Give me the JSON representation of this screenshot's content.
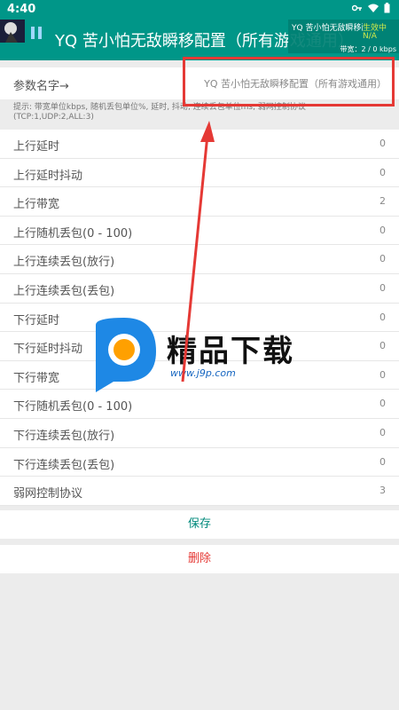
{
  "status_bar": {
    "time": "4:40"
  },
  "app_bar": {
    "title": "YQ 苦小怕无敌瞬移配置（所有游戏通用）"
  },
  "overlay": {
    "name": "YQ 苦小怕无敌瞬移配置",
    "status": "生效中",
    "status2": "N/A",
    "bandwidth": "带宽：2 / 0 kbps"
  },
  "config": {
    "name_label": "参数名字→",
    "name_value": "YQ 苦小怕无敌瞬移配置（所有游戏通用）",
    "hint_line1": "提示: 带宽单位kbps, 随机丢包单位%, 延时, 抖动, 连续丢包单位ms, 弱网控制协议",
    "hint_line2": "(TCP:1,UDP:2,ALL:3)"
  },
  "params": [
    {
      "label": "上行延时",
      "value": "0"
    },
    {
      "label": "上行延时抖动",
      "value": "0"
    },
    {
      "label": "上行带宽",
      "value": "2"
    },
    {
      "label": "上行随机丢包(0 - 100)",
      "value": "0"
    },
    {
      "label": "上行连续丢包(放行)",
      "value": "0"
    },
    {
      "label": "上行连续丢包(丢包)",
      "value": "0"
    },
    {
      "label": "下行延时",
      "value": "0"
    },
    {
      "label": "下行延时抖动",
      "value": "0"
    },
    {
      "label": "下行带宽",
      "value": "0"
    },
    {
      "label": "下行随机丢包(0 - 100)",
      "value": "0"
    },
    {
      "label": "下行连续丢包(放行)",
      "value": "0"
    },
    {
      "label": "下行连续丢包(丢包)",
      "value": "0"
    },
    {
      "label": "弱网控制协议",
      "value": "3"
    }
  ],
  "actions": {
    "save": "保存",
    "delete": "删除"
  },
  "watermark": {
    "text": "精品下载",
    "url": "www.j9p.com"
  },
  "colors": {
    "primary": "#009688",
    "danger": "#e53935",
    "annotation": "#e53935"
  }
}
